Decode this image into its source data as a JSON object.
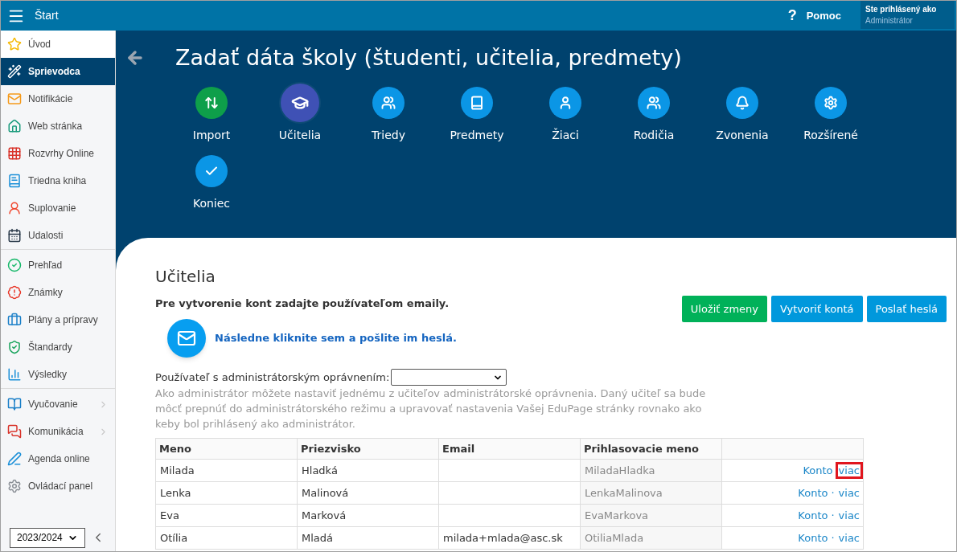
{
  "topbar": {
    "title": "Štart",
    "help_icon": "?",
    "help": "Pomoc",
    "user_label": "Ste prihlásený ako",
    "user_name": "Administrátor"
  },
  "sidebar": {
    "groups": [
      [
        {
          "label": "Úvod",
          "selected": false
        },
        {
          "label": "Sprievodca",
          "selected": true
        },
        {
          "label": "Notifikácie",
          "selected": false
        },
        {
          "label": "Web stránka",
          "selected": false
        },
        {
          "label": "Rozvrhy Online",
          "selected": false
        },
        {
          "label": "Triedna kniha",
          "selected": false
        },
        {
          "label": "Suplovanie",
          "selected": false
        },
        {
          "label": "Udalosti",
          "selected": false
        }
      ],
      [
        {
          "label": "Prehľad",
          "selected": false
        },
        {
          "label": "Známky",
          "selected": false
        },
        {
          "label": "Plány a prípravy",
          "selected": false
        },
        {
          "label": "Štandardy",
          "selected": false
        },
        {
          "label": "Výsledky",
          "selected": false
        }
      ],
      [
        {
          "label": "Vyučovanie",
          "selected": false,
          "has_submenu": true
        },
        {
          "label": "Komunikácia",
          "selected": false,
          "has_submenu": true
        },
        {
          "label": "Agenda online",
          "selected": false,
          "has_submenu": false
        },
        {
          "label": "Ovládací panel",
          "selected": false,
          "has_submenu": false
        }
      ]
    ],
    "year": "2023/2024"
  },
  "header": {
    "title": "Zadať dáta školy (študenti, učitelia, predmety)"
  },
  "steps": [
    {
      "label": "Import",
      "selected": false,
      "color": "#0e9f4a"
    },
    {
      "label": "Učitelia",
      "selected": true,
      "color": "#3f51b5"
    },
    {
      "label": "Triedy",
      "selected": false,
      "color": "#0b96e6"
    },
    {
      "label": "Predmety",
      "selected": false,
      "color": "#0b96e6"
    },
    {
      "label": "Žiaci",
      "selected": false,
      "color": "#0b96e6"
    },
    {
      "label": "Rodičia",
      "selected": false,
      "color": "#0b96e6"
    },
    {
      "label": "Zvonenia",
      "selected": false,
      "color": "#0b96e6"
    },
    {
      "label": "Rozšírené",
      "selected": false,
      "color": "#0b96e6"
    },
    {
      "label": "Koniec",
      "selected": false,
      "color": "#0b96e6"
    }
  ],
  "section": {
    "title": "Učitelia",
    "instruction": "Pre vytvorenie kont zadajte používateľom emaily.",
    "send_link": "Následne kliknite sem a pošlite im heslá.",
    "buttons": [
      {
        "label": "Uložiť zmeny",
        "kind": "save"
      },
      {
        "label": "Vytvoriť kontá",
        "kind": "action"
      },
      {
        "label": "Poslať heslá",
        "kind": "action"
      }
    ],
    "admin_label": "Používateľ s administrátorským oprávnením:",
    "admin_help": "Ako administrátor môžete nastaviť jednému z učiteľov administrátorské oprávnenia. Daný učiteľ sa bude môcť prepnúť do administrátorského režimu a upravovať nastavenia Vašej EduPage stránky rovnako ako keby bol prihlásený ako administrátor."
  },
  "table": {
    "columns": [
      "Meno",
      "Priezvisko",
      "Email",
      "Prihlasovacie meno"
    ],
    "rows": [
      {
        "cells": [
          "Milada",
          "Hladká",
          "",
          "MiladaHladka"
        ],
        "konto": "Konto",
        "viac": "viac",
        "highlighted": true
      },
      {
        "cells": [
          "Lenka",
          "Malinová",
          "",
          "LenkaMalinova"
        ],
        "konto": "Konto",
        "separator": "·",
        "viac": "viac",
        "highlighted": false
      },
      {
        "cells": [
          "Eva",
          "Marková",
          "",
          "EvaMarkova"
        ],
        "konto": "Konto",
        "separator": "·",
        "viac": "viac",
        "highlighted": false
      },
      {
        "cells": [
          "Otília",
          "Mladá",
          "milada+mlada@asc.sk",
          "OtiliaMlada"
        ],
        "konto": "Konto",
        "separator": "·",
        "viac": "viac",
        "highlighted": false
      }
    ]
  }
}
